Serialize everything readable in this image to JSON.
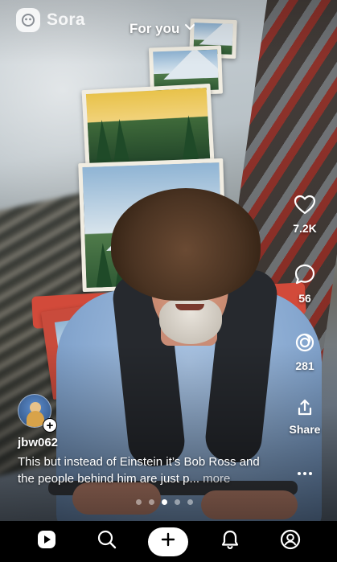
{
  "app": {
    "brand_name": "Sora"
  },
  "header": {
    "feed_label": "For you"
  },
  "actions": {
    "like_count": "7.2K",
    "comment_count": "56",
    "remix_count": "281",
    "share_label": "Share"
  },
  "post": {
    "username": "jbw062",
    "caption": "This but instead of Einstein it’s Bob Ross and the people behind him are just p...",
    "more_label": "more"
  },
  "carousel": {
    "count": 5,
    "active_index": 2
  },
  "nav": {
    "items": [
      "home-icon",
      "search-icon",
      "create-icon",
      "activity-icon",
      "profile-icon"
    ],
    "active": "home-icon"
  },
  "colors": {
    "nav_background": "#000000",
    "create_button": "#ffffff"
  }
}
